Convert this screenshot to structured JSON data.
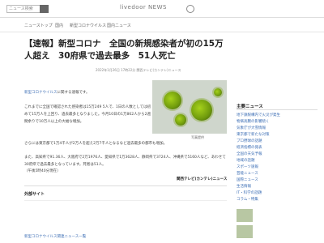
{
  "header": {
    "search_placeholder": "ニュース検索",
    "site_name": "livedoor NEWS"
  },
  "nav": {
    "items": [
      "ニューストップ",
      "国内",
      "新型コロナウイルス",
      "国内ニュース"
    ]
  },
  "article": {
    "title": "【速報】新型コロナ　全国の新規感染者が初の15万人超え　30府県で過去最多　51人死亡",
    "meta": "2022年1月26日 17時22分  関西テレビ(カンテレ)ニュース",
    "lead_link": "新型コロナウイルス",
    "lead_rest": "に関する速報です。",
    "paragraphs": [
      "これまでに全国で確認された感染者は15万249 5人で、1日の人数としては初めて15万人を上回り、過去最多となりました。今月10日の1万862人から2週間余りで10万人以上の大幅な増加。",
      "さらには東京都で1万4千人が2万人を超え2万7千人となるなど過去最多の都市も増加。",
      "また、高知県で91.36人、大阪府で2万1976人、愛知県で1万3628人、静岡県で3724人、沖縄県で5160人など、あわせて30府県で過去最多となっています。死者は51人。",
      "（午後5時40分現在）"
    ],
    "photo_caption": "写真提供",
    "credit": "関西テレビ(カンテレ)ニュース"
  },
  "related": {
    "title": "外部サイト",
    "text": "新型コロナウイルス関連ニュース一覧"
  },
  "sidebar": {
    "title": "主要ニュース",
    "items": [
      "地下鉄駅構内で火災が発生",
      "物価高騰の影響続く",
      "気象庁が大雪情報",
      "東京都で新たな対策",
      "プロ野球の話題",
      "経済指標の発表",
      "全国の天気予報",
      "地域の話題",
      "スポーツ速報",
      "芸能ニュース",
      "国際ニュース",
      "生活情報",
      "IT・科学の話題",
      "コラム・特集"
    ]
  }
}
